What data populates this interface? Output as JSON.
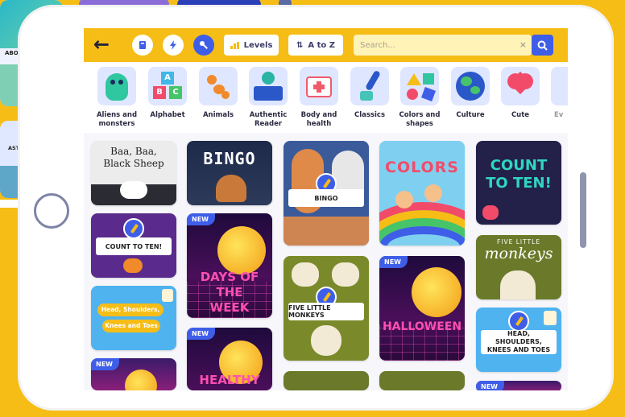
{
  "background_cards": [
    {
      "text": "ABOMO"
    },
    {
      "text": "AST AD"
    }
  ],
  "toolbar": {
    "levels_label": "Levels",
    "sort_label": "A to Z",
    "search_placeholder": "Search...",
    "clear_label": "×"
  },
  "categories": [
    {
      "label": "Aliens and monsters",
      "icon": "alien-icon"
    },
    {
      "label": "Alphabet",
      "icon": "abc-blocks-icon"
    },
    {
      "label": "Animals",
      "icon": "paw-icon"
    },
    {
      "label": "Authentic Reader",
      "icon": "reader-icon"
    },
    {
      "label": "Body and health",
      "icon": "medical-kit-icon"
    },
    {
      "label": "Classics",
      "icon": "quill-icon"
    },
    {
      "label": "Colors and shapes",
      "icon": "shapes-icon"
    },
    {
      "label": "Culture",
      "icon": "globe-icon"
    },
    {
      "label": "Cute",
      "icon": "heart-icon"
    },
    {
      "label": "Ev",
      "icon": "partial-icon"
    }
  ],
  "tiles": {
    "baa_title": "Baa, Baa, Black Sheep",
    "bingo_title": "BINGO",
    "bingo_banner": "BINGO",
    "colors_title": "COLORS",
    "count_title": "COUNT TO TEN!",
    "count_banner": "COUNT TO TEN!",
    "days_title": "DAYS OF THE WEEK",
    "five_banner": "FIVE LITTLE MONKEYS",
    "five_title_small": "FIVE LITTLE",
    "five_title_big": "monkeys",
    "halloween_title": "HALLOWEEN",
    "head_title_1": "Head, Shoulders,",
    "head_title_2": "Knees and Toes",
    "head_banner": "HEAD, SHOULDERS, KNEES AND TOES",
    "healthy_title": "HEALTHY",
    "new_badge": "NEW"
  },
  "colors": {
    "accent_yellow": "#f6bd16",
    "accent_blue": "#3f5ee8"
  }
}
